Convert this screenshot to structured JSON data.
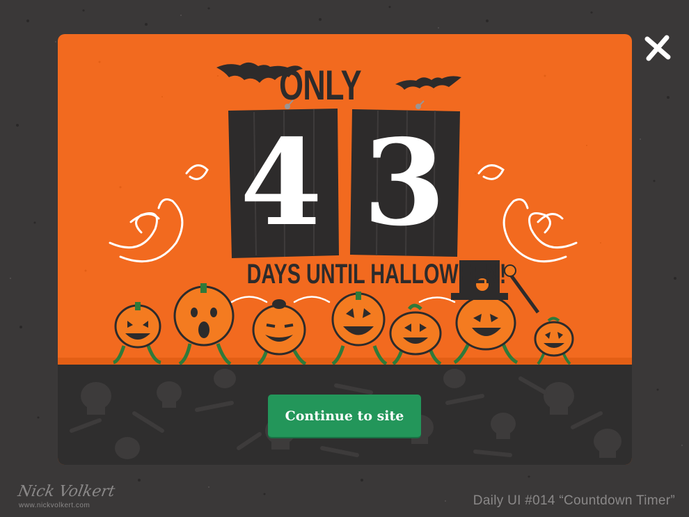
{
  "modal": {
    "headline_top": "ONLY",
    "countdown_digits": [
      "4",
      "3"
    ],
    "headline_bottom": "DAYS UNTIL HALLOWEEN!",
    "cta_label": "Continue to site"
  },
  "credits": {
    "signature": "Nick Volkert",
    "url": "www.nickvolkert.com",
    "project": "Daily UI #014 “Countdown Timer”"
  },
  "colors": {
    "page_bg": "#3a3838",
    "hero_orange": "#f26a1f",
    "footer_dark": "#2f2e2e",
    "wood": "#2d2b2b",
    "cta_green": "#23965a",
    "pumpkin": "#f47b20",
    "vine": "#2f7a3a"
  },
  "icons": [
    "close-icon",
    "bat-icon",
    "pumpkin-icon",
    "skull-icon",
    "bone-icon",
    "nail-icon",
    "swirl-icon"
  ]
}
